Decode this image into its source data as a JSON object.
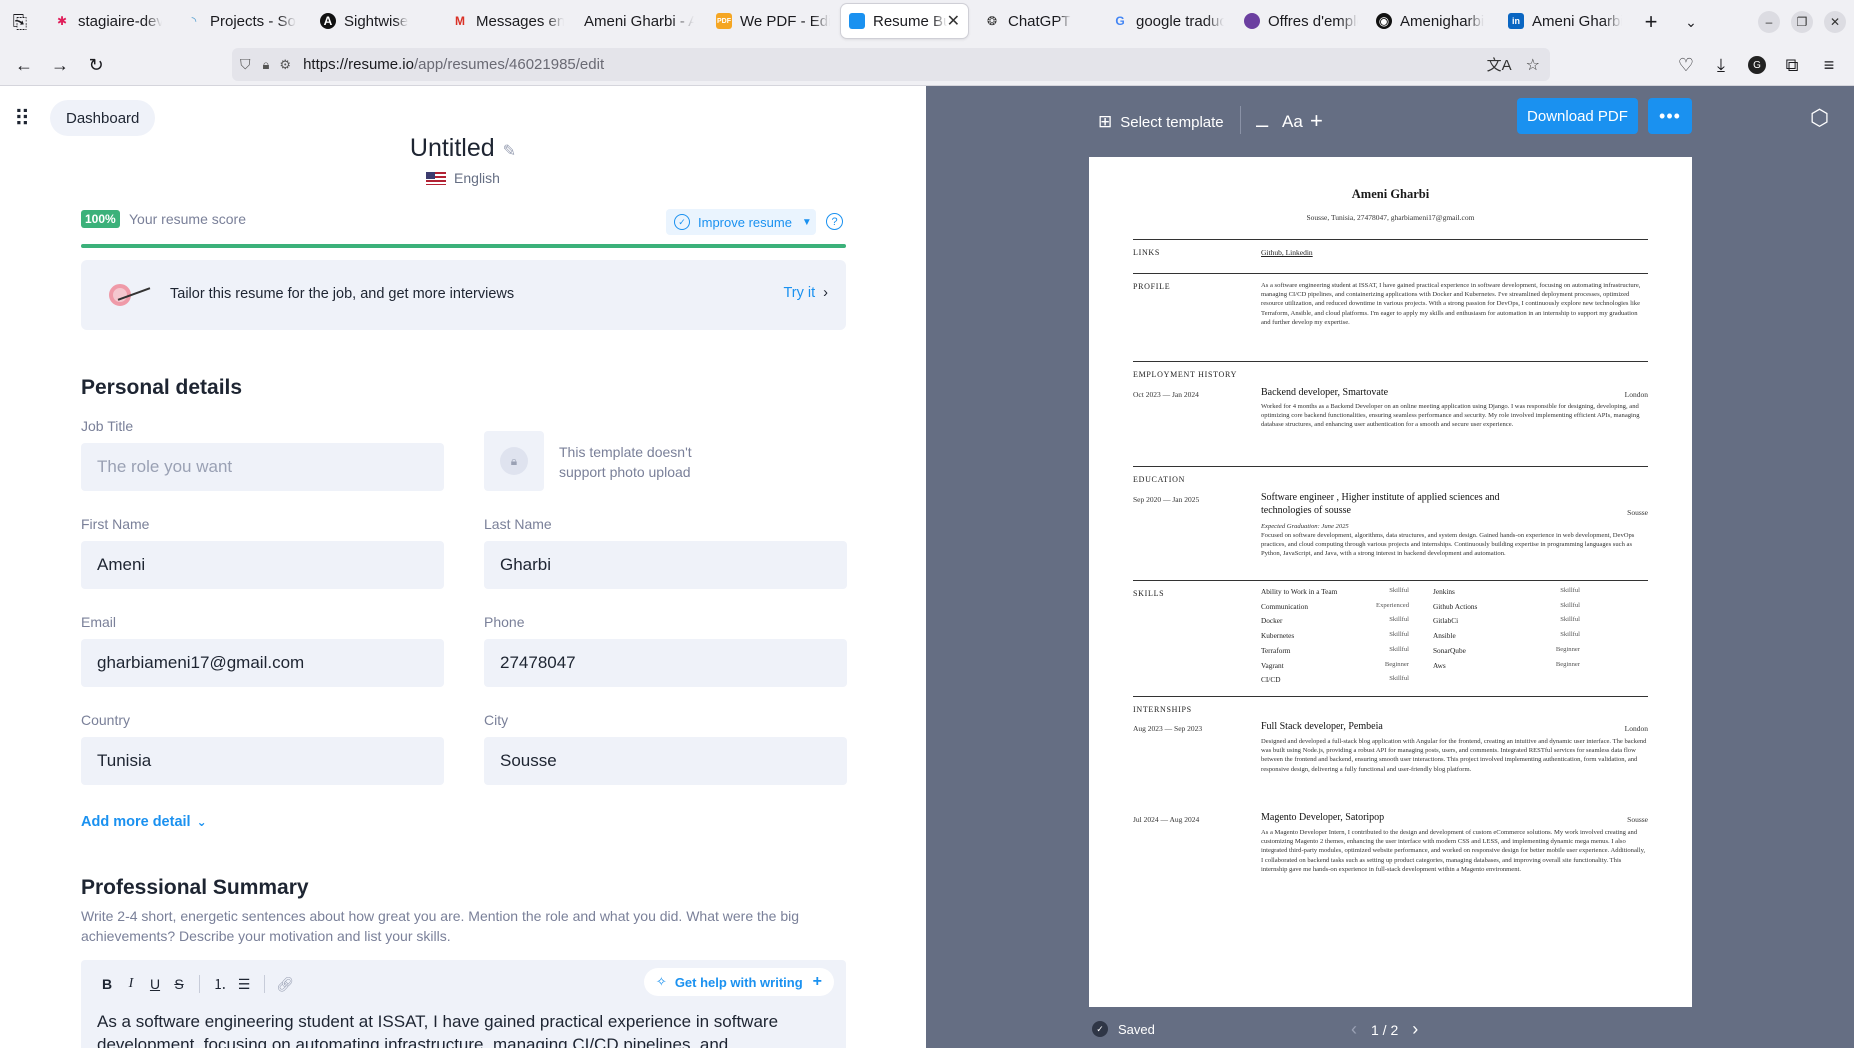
{
  "browser": {
    "tabs": [
      {
        "label": "stagiaire-devops",
        "icon": "slack-icon"
      },
      {
        "label": "Projects - SonarQube",
        "icon": "sonarqube-icon"
      },
      {
        "label": "Sightwise",
        "icon": "sightwise-icon"
      },
      {
        "label": "Messages envoyés",
        "icon": "gmail-icon"
      },
      {
        "label": "Ameni Gharbi - A",
        "icon": "none"
      },
      {
        "label": "We PDF - Edit",
        "icon": "pdf-icon"
      },
      {
        "label": "Resume Builder",
        "icon": "resume-icon"
      },
      {
        "label": "ChatGPT",
        "icon": "chatgpt-icon"
      },
      {
        "label": "google traduction",
        "icon": "google-icon"
      },
      {
        "label": "Offres d'emploi",
        "icon": "offres-icon"
      },
      {
        "label": "Amenigharbi",
        "icon": "github-icon"
      },
      {
        "label": "Ameni Gharbi",
        "icon": "linkedin-icon"
      }
    ],
    "url_host": "https://resume.io",
    "url_path": "/app/resumes/46021985/edit"
  },
  "editor": {
    "dashboard": "Dashboard",
    "title": "Untitled",
    "language": "English",
    "score_pct": "100%",
    "score_label": "Your resume score",
    "improve": "Improve resume",
    "tailor": "Tailor this resume for the job, and get more interviews",
    "try_it": "Try it",
    "personal_details": "Personal details",
    "job_title_label": "Job Title",
    "job_title_placeholder": "The role you want",
    "photo_note": "This template doesn't support photo upload",
    "first_name_label": "First Name",
    "first_name": "Ameni",
    "last_name_label": "Last Name",
    "last_name": "Gharbi",
    "email_label": "Email",
    "email": "gharbiameni17@gmail.com",
    "phone_label": "Phone",
    "phone": "27478047",
    "country_label": "Country",
    "country": "Tunisia",
    "city_label": "City",
    "city": "Sousse",
    "add_more": "Add more detail",
    "summary_title": "Professional Summary",
    "summary_hint": "Write 2-4 short, energetic sentences about how great you are. Mention the role and what you did. What were the big achievements? Describe your motivation and list your skills.",
    "help_writing": "Get help with writing",
    "summary_text": "As a software engineering student at ISSAT, I have gained practical experience in software development, focusing on automating infrastructure, managing CI/CD pipelines, and"
  },
  "preview": {
    "select_template": "Select template",
    "font_label": "Aa",
    "download": "Download PDF",
    "saved": "Saved",
    "pages": "1 / 2"
  },
  "resume": {
    "name": "Ameni Gharbi",
    "contact": "Sousse, Tunisia, 27478047, gharbiameni17@gmail.com",
    "links_h": "LINKS",
    "links": "Github, Linkedin",
    "profile_h": "PROFILE",
    "profile": "As a software engineering student at ISSAT, I have gained practical experience in software development, focusing on automating infrastructure, managing CI/CD pipelines, and containerizing applications with Docker and Kubernetes. I've streamlined deployment processes, optimized resource utilization, and reduced downtime in various projects. With a strong passion for DevOps, I continuously explore new technologies like Terraform, Ansible, and cloud platforms. I'm eager to apply my skills and enthusiasm for automation in an internship to support my graduation and further develop my expertise.",
    "employment_h": "EMPLOYMENT HISTORY",
    "emp_date": "Oct 2023 — Jan 2024",
    "emp_title": "Backend developer, Smartovate",
    "emp_loc": "London",
    "emp_desc": "Worked for 4 months as a Backend Developer on an online meeting application using Django. I was responsible for designing, developing, and optimizing core backend functionalities, ensuring seamless performance and security. My role involved implementing efficient APIs, managing database structures, and enhancing user authentication for a smooth and secure user experience.",
    "education_h": "EDUCATION",
    "edu_date": "Sep 2020 — Jan 2025",
    "edu_title": "Software engineer , Higher institute of applied sciences and technologies of sousse",
    "edu_loc": "Sousse",
    "edu_grad": "Expected Graduation: June 2025",
    "edu_desc": "Focused on software development, algorithms, data structures, and system design. Gained hands-on experience in web development, DevOps practices, and cloud computing through various projects and internships. Continuously building expertise in programming languages such as Python, JavaScript, and Java, with a strong interest in backend development and automation.",
    "skills_h": "SKILLS",
    "skills_left": [
      {
        "name": "Ability to Work in a Team",
        "level": "Skillful"
      },
      {
        "name": "Communication",
        "level": "Experienced"
      },
      {
        "name": "Docker",
        "level": "Skillful"
      },
      {
        "name": "Kubernetes",
        "level": "Skillful"
      },
      {
        "name": "Terraform",
        "level": "Skillful"
      },
      {
        "name": "Vagrant",
        "level": "Beginner"
      },
      {
        "name": "CI/CD",
        "level": "Skillful"
      }
    ],
    "skills_right": [
      {
        "name": "Jenkins",
        "level": "Skillful"
      },
      {
        "name": "Github Actions",
        "level": "Skillful"
      },
      {
        "name": "GitlabCi",
        "level": "Skillful"
      },
      {
        "name": "Ansible",
        "level": "Skillful"
      },
      {
        "name": "SonarQube",
        "level": "Beginner"
      },
      {
        "name": "Aws",
        "level": "Beginner"
      }
    ],
    "internships_h": "INTERNSHIPS",
    "int1_date": "Aug 2023 — Sep 2023",
    "int1_title": "Full Stack developer, Pembeia",
    "int1_loc": "London",
    "int1_desc": "Designed and developed a full-stack blog application with Angular for the frontend, creating an intuitive and dynamic user interface. The backend was built using Node.js, providing a robust API for managing posts, users, and comments. Integrated RESTful services for seamless data flow between the frontend and backend, ensuring smooth user interactions. This project involved implementing authentication, form validation, and responsive design, delivering a fully functional and user-friendly blog platform.",
    "int2_date": "Jul 2024 — Aug 2024",
    "int2_title": "Magento Developer, Satoripop",
    "int2_loc": "Sousse",
    "int2_desc": "As a Magento Developer Intern, I contributed to the design and development of custom eCommerce solutions. My work involved creating and customizing Magento 2 themes, enhancing the user interface with modern CSS and LESS, and implementing dynamic mega menus. I also integrated third-party modules, optimized website performance, and worked on responsive design for better mobile user experience. Additionally, I collaborated on backend tasks such as setting up product categories, managing databases, and improving overall site functionality. This internship gave me hands-on experience in full-stack development within a Magento environment."
  },
  "colors": {
    "accent": "#1a91f0",
    "score_green": "#3bb17a",
    "preview_bg": "#656e83"
  }
}
